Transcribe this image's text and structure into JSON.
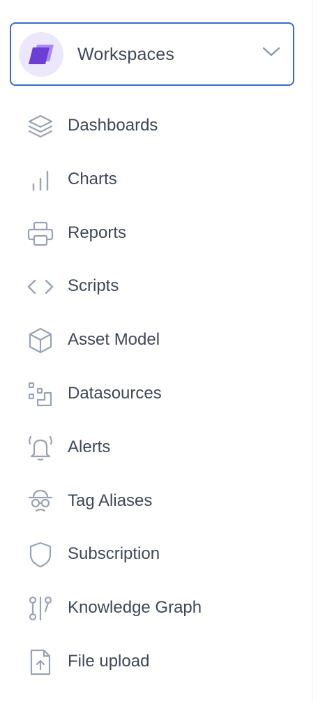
{
  "workspace": {
    "label": "Workspaces",
    "icon": "workspace-layers-icon",
    "accent": "#7b4fe0",
    "border_color": "#3b6bc8"
  },
  "nav": {
    "items": [
      {
        "label": "Dashboards",
        "icon": "layers-icon"
      },
      {
        "label": "Charts",
        "icon": "bar-chart-icon"
      },
      {
        "label": "Reports",
        "icon": "printer-icon"
      },
      {
        "label": "Scripts",
        "icon": "code-icon"
      },
      {
        "label": "Asset Model",
        "icon": "cube-icon"
      },
      {
        "label": "Datasources",
        "icon": "datasource-icon"
      },
      {
        "label": "Alerts",
        "icon": "bell-ringing-icon"
      },
      {
        "label": "Tag Aliases",
        "icon": "incognito-icon"
      },
      {
        "label": "Subscription",
        "icon": "shield-icon"
      },
      {
        "label": "Knowledge Graph",
        "icon": "graph-icon"
      },
      {
        "label": "File upload",
        "icon": "file-upload-icon"
      }
    ],
    "text_color": "#3f4756",
    "icon_color": "#9aa3b2"
  }
}
